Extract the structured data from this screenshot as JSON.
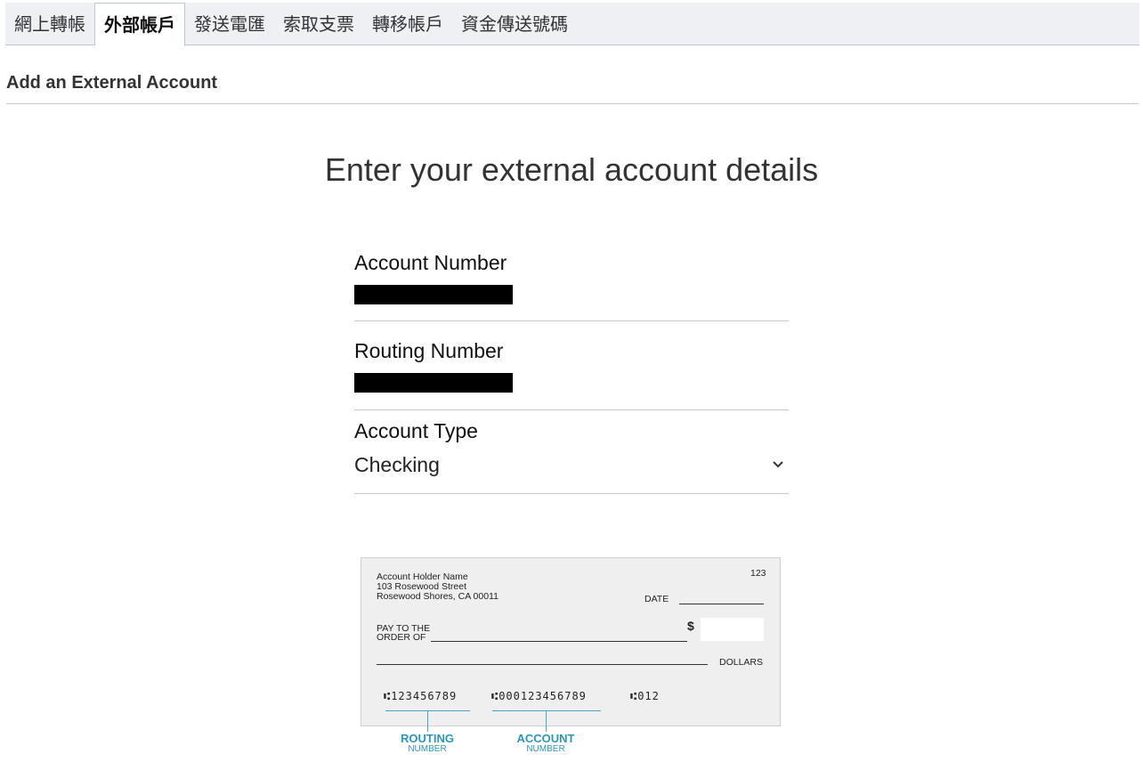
{
  "tabs": [
    {
      "label": "網上轉帳",
      "active": false
    },
    {
      "label": "外部帳戶",
      "active": true
    },
    {
      "label": "發送電匯",
      "active": false
    },
    {
      "label": "索取支票",
      "active": false
    },
    {
      "label": "轉移帳戶",
      "active": false
    },
    {
      "label": "資金傳送號碼",
      "active": false
    }
  ],
  "section_title": "Add an External Account",
  "headline": "Enter your external account details",
  "form": {
    "account_number_label": "Account Number",
    "routing_number_label": "Routing Number",
    "account_type_label": "Account Type",
    "account_type_value": "Checking"
  },
  "check": {
    "holder_name": "Account Holder Name",
    "street": "103 Rosewood Street",
    "city": "Rosewood Shores, CA 00011",
    "number": "123",
    "date_label": "DATE",
    "pay_to_line1": "PAY TO THE",
    "pay_to_line2": "ORDER OF",
    "dollar_sign": "$",
    "dollars_label": "DOLLARS",
    "micr_routing": "⑆123456789",
    "micr_account": "⑆000123456789",
    "micr_check": "⑆012",
    "routing_caption": "ROUTING",
    "routing_caption_sub": "NUMBER",
    "account_caption": "ACCOUNT",
    "account_caption_sub": "NUMBER"
  },
  "colors": {
    "tab_bar_bg": "#eef0f3",
    "tab_border": "#b9c8d8",
    "caption_blue": "#2e95bd",
    "redaction": "#000000"
  }
}
